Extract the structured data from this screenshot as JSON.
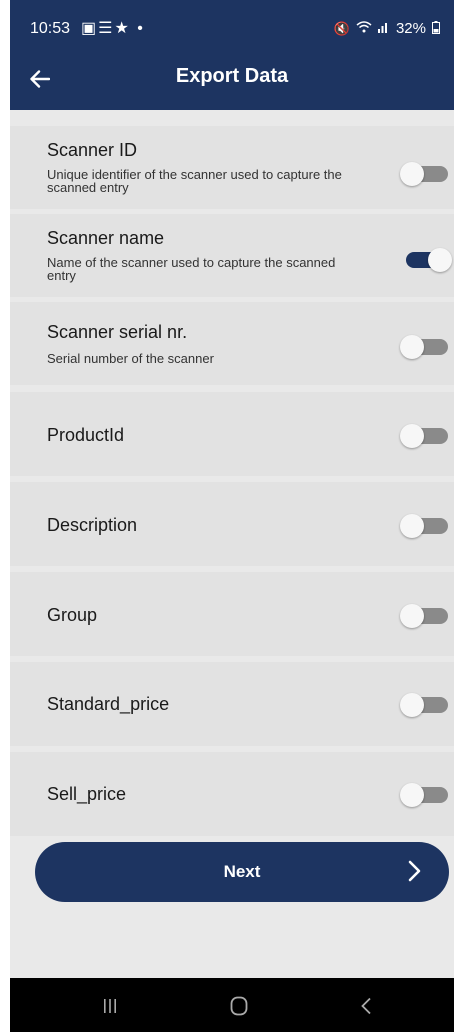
{
  "status_bar": {
    "time": "10:53",
    "left_icons": [
      "gallery-icon",
      "menu-icon",
      "accessibility-icon",
      "dot-icon"
    ],
    "battery": "32%",
    "right_icons": [
      "mute-icon",
      "wifi-icon",
      "signal-icon",
      "battery-icon"
    ]
  },
  "header": {
    "title": "Export Data"
  },
  "fields": [
    {
      "title": "Scanner ID",
      "description": "Unique identifier of the scanner used to capture the scanned entry",
      "enabled": false
    },
    {
      "title": "Scanner name",
      "description": "Name of the scanner used to capture the scanned entry",
      "enabled": true
    },
    {
      "title": "Scanner serial nr.",
      "description": "Serial number of the scanner",
      "enabled": false
    },
    {
      "title": "ProductId",
      "description": "",
      "enabled": false
    },
    {
      "title": "Description",
      "description": "",
      "enabled": false
    },
    {
      "title": "Group",
      "description": "",
      "enabled": false
    },
    {
      "title": "Standard_price",
      "description": "",
      "enabled": false
    },
    {
      "title": "Sell_price",
      "description": "",
      "enabled": false
    }
  ],
  "next_button": {
    "label": "Next"
  },
  "colors": {
    "primary": "#1d3461",
    "row_background": "#e2e2e2",
    "page_background": "#e9e9e9",
    "toggle_off": "#8a8a8a"
  }
}
